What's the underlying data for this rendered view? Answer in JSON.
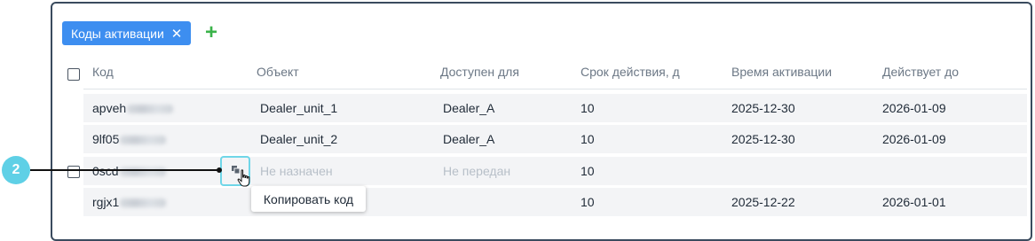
{
  "filter_chip": {
    "label": "Коды активации",
    "close_glyph": "✕"
  },
  "add_glyph": "+",
  "columns": [
    "Код",
    "Объект",
    "Доступен для",
    "Срок действия, д",
    "Время активации",
    "Действует до"
  ],
  "rows": [
    {
      "code": "apveh",
      "object": "Dealer_unit_1",
      "available_for": "Dealer_A",
      "validity_days": "10",
      "activated": "2025-12-30",
      "valid_until": "2026-01-09",
      "dimmed": false
    },
    {
      "code": "9lf05",
      "object": "Dealer_unit_2",
      "available_for": "Dealer_A",
      "validity_days": "10",
      "activated": "2025-12-30",
      "valid_until": "2026-01-09",
      "dimmed": false
    },
    {
      "code": "0scd",
      "object": "Не назначен",
      "available_for": "Не передан",
      "validity_days": "10",
      "activated": "",
      "valid_until": "",
      "dimmed": true
    },
    {
      "code": "rgjx1",
      "object": "",
      "available_for": "",
      "validity_days": "10",
      "activated": "2025-12-22",
      "valid_until": "2026-01-01",
      "dimmed": false
    }
  ],
  "tooltip": "Копировать код",
  "callout_number": "2",
  "colors": {
    "chip_bg": "#3d8ef0",
    "add_green": "#3bb34a",
    "callout": "#5fd0e6",
    "row_bg": "#f3f4f6"
  }
}
